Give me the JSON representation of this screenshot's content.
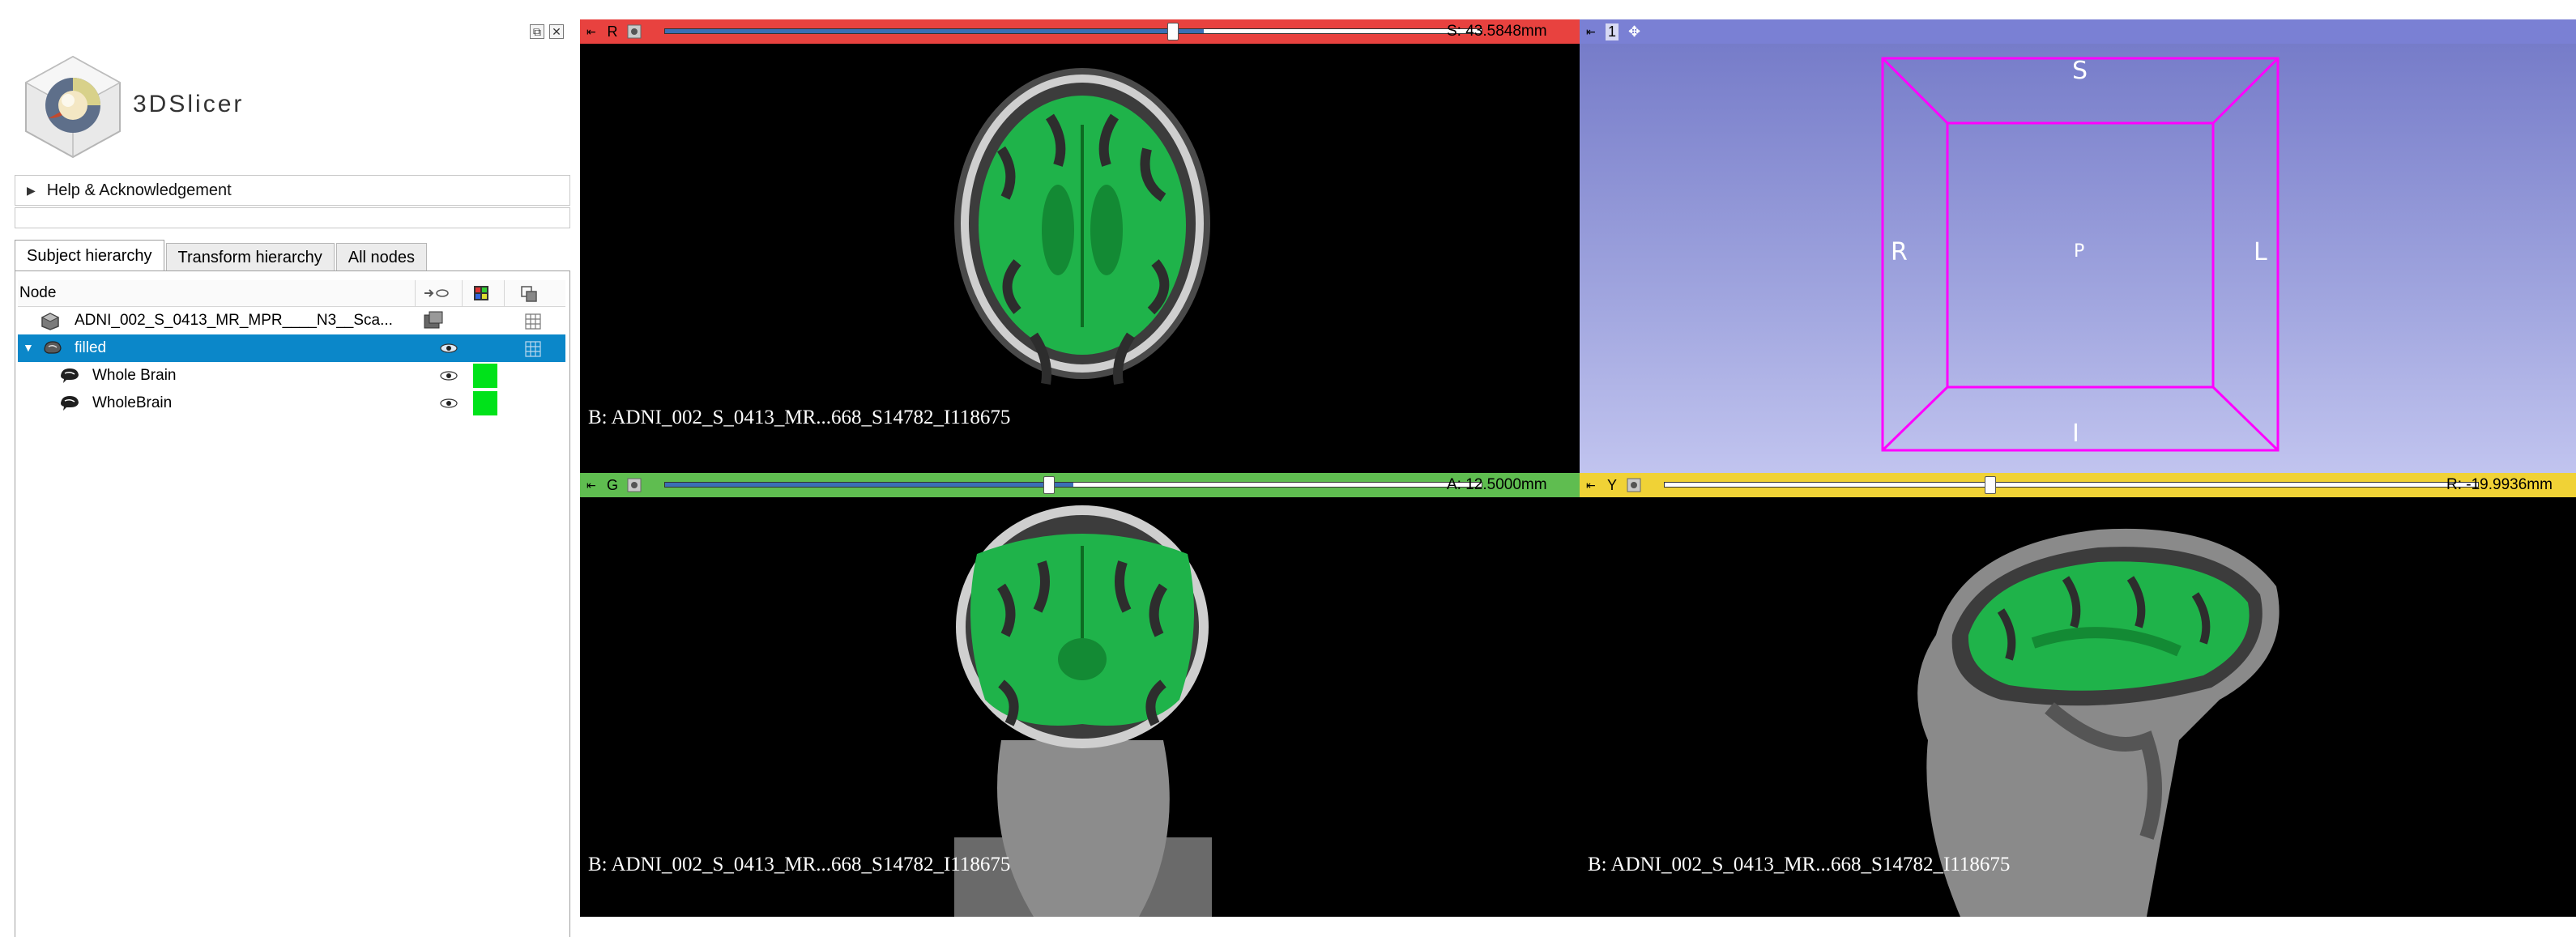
{
  "app": {
    "name": "3DSlicer"
  },
  "panel": {
    "dock_float_icon": "⧉",
    "dock_close_icon": "✕",
    "help_section": {
      "label": "Help & Acknowledgement"
    },
    "tabs": [
      {
        "label": "Subject hierarchy",
        "active": true
      },
      {
        "label": "Transform hierarchy",
        "active": false
      },
      {
        "label": "All nodes",
        "active": false
      }
    ],
    "tree": {
      "header": {
        "node_label": "Node"
      },
      "rows": [
        {
          "label": "ADNI_002_S_0413_MR_MPR____N3__Sca...",
          "icon": "volume-icon",
          "selected": false
        },
        {
          "label": "filled",
          "icon": "segmentation-icon",
          "selected": true
        },
        {
          "label": "Whole Brain",
          "icon": "segment-icon",
          "color": "#00e21a",
          "selected": false
        },
        {
          "label": "WholeBrain",
          "icon": "segment-icon",
          "color": "#00e21a",
          "selected": false
        }
      ]
    }
  },
  "views": {
    "red": {
      "letter": "R",
      "value": "S: 43.5848mm",
      "slider_position": 0.65,
      "label": "B: ADNI_002_S_0413_MR...668_S14782_I118675",
      "bar_color": "#e8423f"
    },
    "threed": {
      "letter": "1",
      "bar_color": "#7a80d4",
      "orientation": {
        "S": "S",
        "I": "I",
        "R": "R",
        "L": "L",
        "P": "P"
      }
    },
    "green": {
      "letter": "G",
      "value": "A: 12.5000mm",
      "slider_position": 0.5,
      "label": "B: ADNI_002_S_0413_MR...668_S14782_I118675",
      "bar_color": "#5fbd50"
    },
    "yellow": {
      "letter": "Y",
      "value": "R: -19.9936mm",
      "slider_position": 0.42,
      "label": "B: ADNI_002_S_0413_MR...668_S14782_I118675",
      "bar_color": "#f0d236"
    }
  },
  "colors": {
    "selection": "#0b87c9",
    "segment": "#00e21a",
    "cube_outline": "#ff00ff"
  }
}
